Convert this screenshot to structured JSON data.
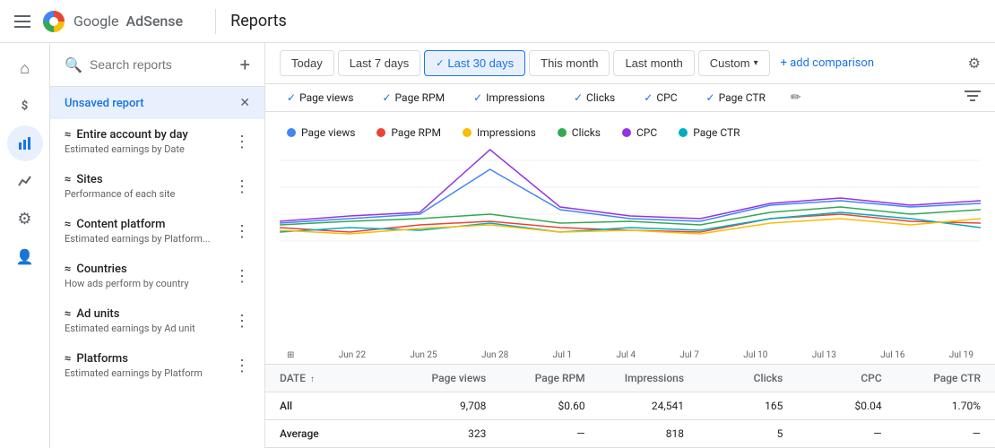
{
  "app": {
    "title": "Google AdSense",
    "page": "Reports",
    "logo_text": "Google",
    "logo_brand": "AdSense"
  },
  "date_filters": {
    "today": "Today",
    "last7": "Last 7 days",
    "last30": "Last 30 days",
    "this_month": "This month",
    "last_month": "Last month",
    "custom": "Custom",
    "add_comparison": "+ add comparison",
    "active": "last30"
  },
  "metric_chips": [
    {
      "id": "page_views",
      "label": "Page views",
      "color": "#4285f4",
      "active": true
    },
    {
      "id": "page_rpm",
      "label": "Page RPM",
      "color": "#ea4335",
      "active": true
    },
    {
      "id": "impressions",
      "label": "Impressions",
      "color": "#fbbc04",
      "active": true
    },
    {
      "id": "clicks",
      "label": "Clicks",
      "color": "#34a853",
      "active": true
    },
    {
      "id": "cpc",
      "label": "CPC",
      "color": "#9334e6",
      "active": true
    },
    {
      "id": "page_ctr",
      "label": "Page CTR",
      "color": "#00acc1",
      "active": true
    }
  ],
  "legend": [
    {
      "label": "Page views",
      "color": "#4285f4"
    },
    {
      "label": "Page RPM",
      "color": "#ea4335"
    },
    {
      "label": "Impressions",
      "color": "#fbbc04"
    },
    {
      "label": "Clicks",
      "color": "#34a853"
    },
    {
      "label": "CPC",
      "color": "#9334e6"
    },
    {
      "label": "Page CTR",
      "color": "#00acc1"
    }
  ],
  "chart_dates": [
    "Jun 22",
    "Jun 25",
    "Jun 28",
    "Jul 1",
    "Jul 4",
    "Jul 7",
    "Jul 10",
    "Jul 13",
    "Jul 16",
    "Jul 19"
  ],
  "table": {
    "headers": [
      "DATE",
      "Page views",
      "Page RPM",
      "Impressions",
      "Clicks",
      "CPC",
      "Page CTR"
    ],
    "rows": [
      {
        "date": "All",
        "page_views": "9,708",
        "page_rpm": "$0.60",
        "impressions": "24,541",
        "clicks": "165",
        "cpc": "$0.04",
        "page_ctr": "1.70%"
      },
      {
        "date": "Average",
        "page_views": "323",
        "page_rpm": "—",
        "impressions": "818",
        "clicks": "5",
        "cpc": "—",
        "page_ctr": "—"
      }
    ]
  },
  "sidebar": {
    "search_placeholder": "Search reports",
    "unsaved_label": "Unsaved report",
    "items": [
      {
        "id": "entire_account",
        "title": "Entire account by day",
        "subtitle": "Estimated earnings by Date",
        "icon": "~"
      },
      {
        "id": "sites",
        "title": "Sites",
        "subtitle": "Performance of each site",
        "icon": "~"
      },
      {
        "id": "content_platform",
        "title": "Content platform",
        "subtitle": "Estimated earnings by Platform...",
        "icon": "~"
      },
      {
        "id": "countries",
        "title": "Countries",
        "subtitle": "How ads perform by country",
        "icon": "~"
      },
      {
        "id": "ad_units",
        "title": "Ad units",
        "subtitle": "Estimated earnings by Ad unit",
        "icon": "~"
      },
      {
        "id": "platforms",
        "title": "Platforms",
        "subtitle": "Estimated earnings by Platform",
        "icon": "~"
      }
    ]
  },
  "sidebar_icons": [
    {
      "id": "home",
      "symbol": "⌂",
      "active": false
    },
    {
      "id": "earnings",
      "symbol": "$",
      "active": false
    },
    {
      "id": "reports",
      "symbol": "📊",
      "active": true
    },
    {
      "id": "performance",
      "symbol": "📈",
      "active": false
    },
    {
      "id": "settings",
      "symbol": "⚙",
      "active": false
    },
    {
      "id": "account",
      "symbol": "👤",
      "active": false
    }
  ]
}
